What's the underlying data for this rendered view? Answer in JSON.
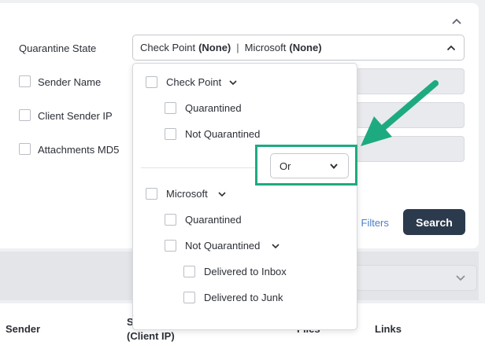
{
  "filters": {
    "quarantine_state_label": "Quarantine State",
    "sender_name_label": "Sender Name",
    "client_sender_ip_label": "Client Sender IP",
    "attachments_md5_label": "Attachments MD5",
    "quarantine_select": {
      "vendor1": "Check Point",
      "vendor1_value": "(None)",
      "separator": "|",
      "vendor2": "Microsoft",
      "vendor2_value": "(None)"
    },
    "advanced_filters_link": "l Filters",
    "search_label": "Search"
  },
  "dropdown": {
    "group1_label": "Check Point",
    "group1_items": [
      "Quarantined",
      "Not Quarantined"
    ],
    "operator_value": "Or",
    "group2_label": "Microsoft",
    "group2_items": [
      "Quarantined",
      "Not Quarantined"
    ],
    "not_quarantined_subitems": [
      "Delivered to Inbox",
      "Delivered to Junk"
    ]
  },
  "table": {
    "headers": {
      "sender": "Sender",
      "sender_ip_partial": "S",
      "sender_ip_line2": "(Client IP)",
      "files_partial": "Files",
      "links": "Links"
    }
  },
  "colors": {
    "highlight": "#1eaa80",
    "search_button": "#2c3a4d",
    "link": "#4a7fc9"
  }
}
